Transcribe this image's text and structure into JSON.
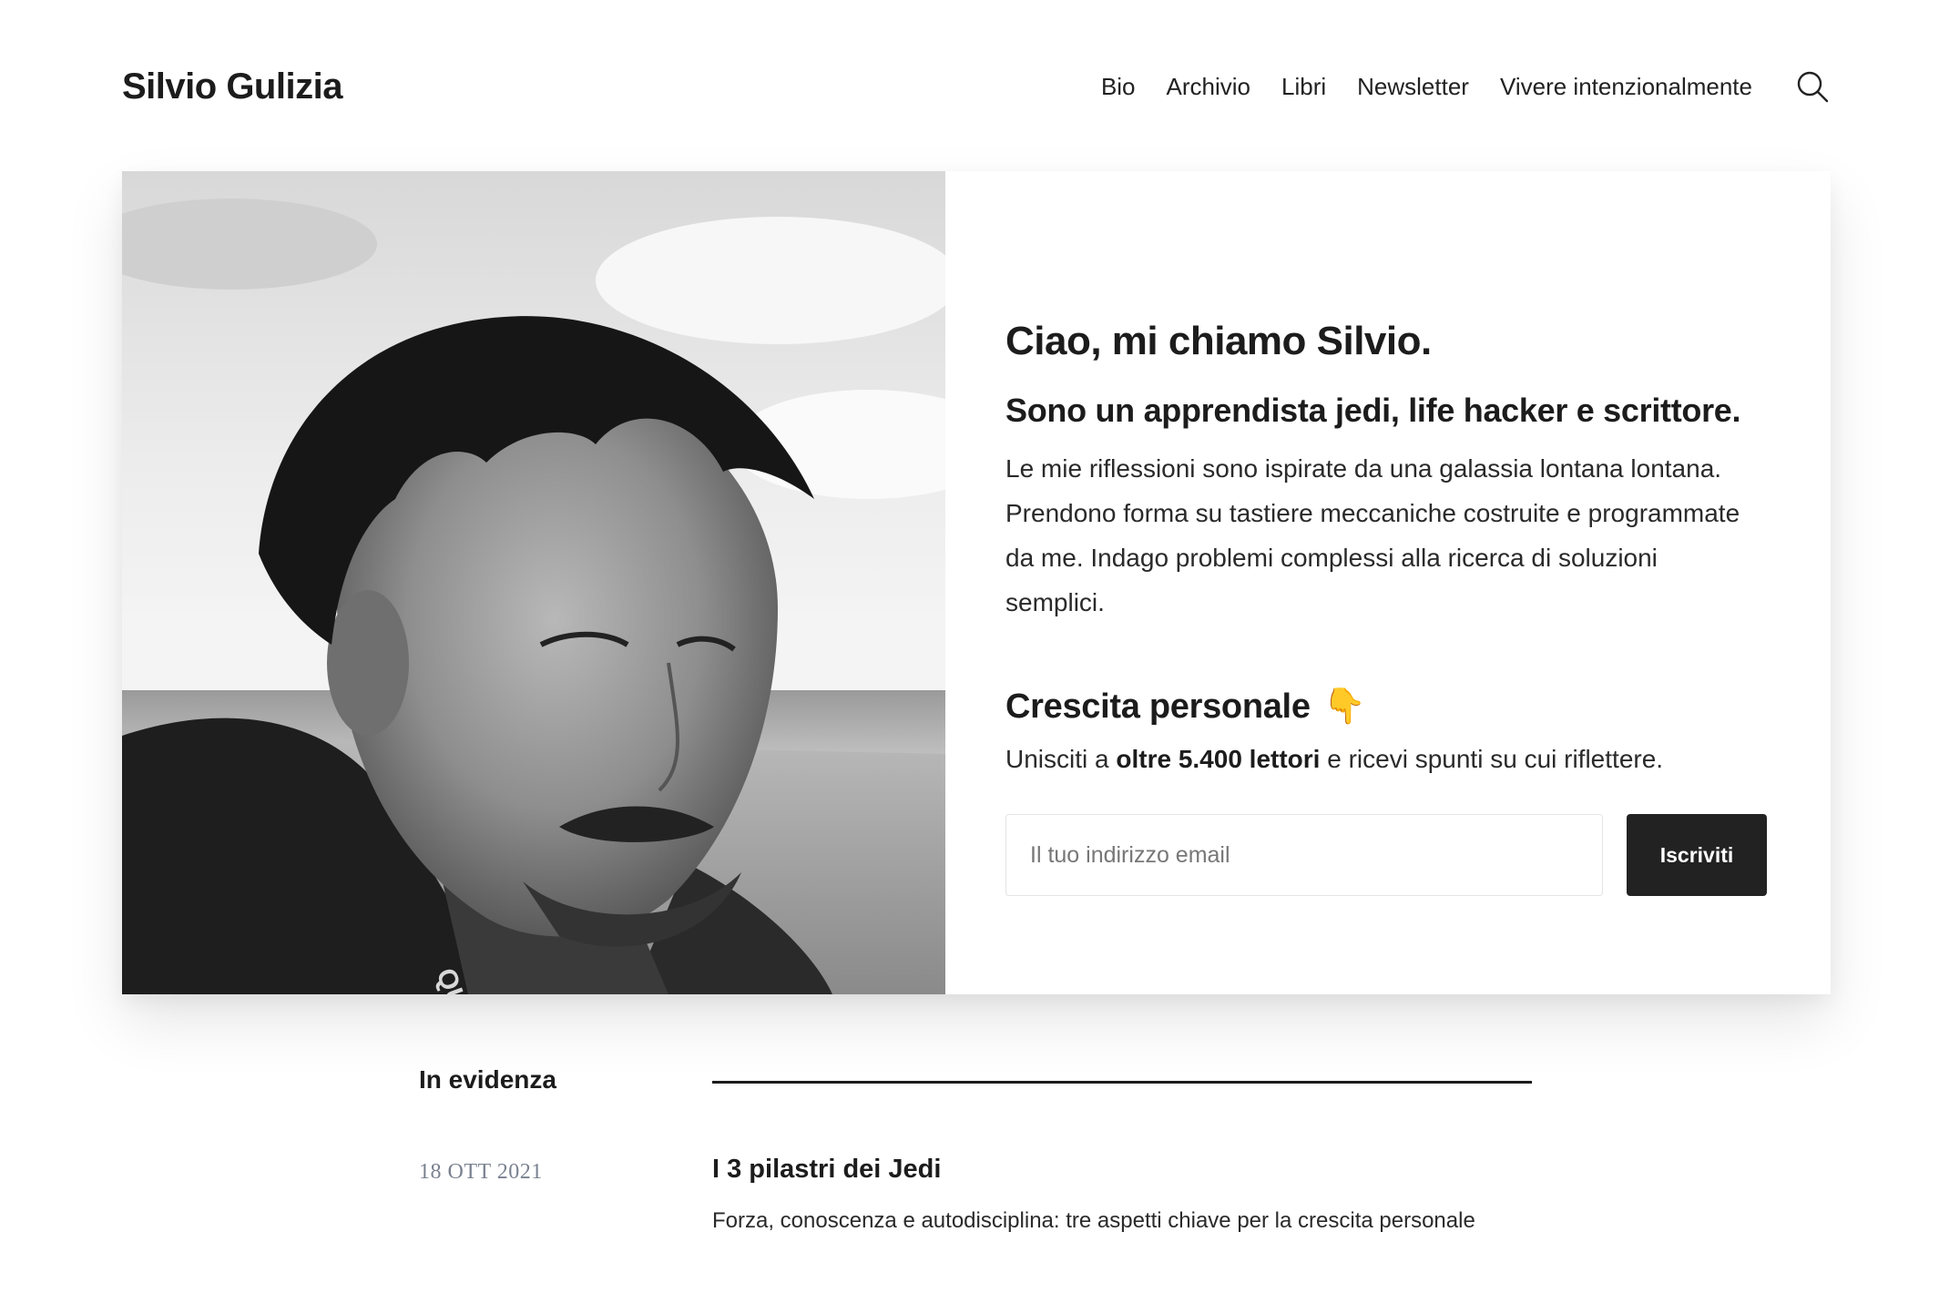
{
  "site": {
    "title": "Silvio Gulizia"
  },
  "nav": {
    "items": [
      "Bio",
      "Archivio",
      "Libri",
      "Newsletter",
      "Vivere intenzionalmente"
    ],
    "search_icon": "search-icon"
  },
  "hero": {
    "title": "Ciao, mi chiamo Silvio.",
    "subtitle": "Sono un apprendista jedi, life hacker e scrittore.",
    "description": "Le mie riflessioni sono ispirate da una galassia lontana lontana. Prendono forma su tastiere meccaniche costruite e programmate da me. Indago problemi complessi alla ricerca di soluzioni semplici.",
    "photo_icon": "portrait-photo"
  },
  "newsletter": {
    "title": "Crescita personale",
    "emoji": "👇",
    "desc_before": "Unisciti a ",
    "desc_strong": "oltre 5.400 lettori",
    "desc_after": " e ricevi spunti su cui riflettere.",
    "email_placeholder": "Il tuo indirizzo email",
    "email_value": "",
    "button_label": "Iscriviti"
  },
  "featured": {
    "label": "In evidenza",
    "posts": [
      {
        "date": "18 OTT 2021",
        "title": "I 3 pilastri dei Jedi",
        "excerpt": "Forza, conoscenza e autodisciplina: tre aspetti chiave per la crescita personale"
      }
    ]
  },
  "colors": {
    "text": "#1c1c1c",
    "button_bg": "#222222",
    "date": "#7a8190"
  }
}
